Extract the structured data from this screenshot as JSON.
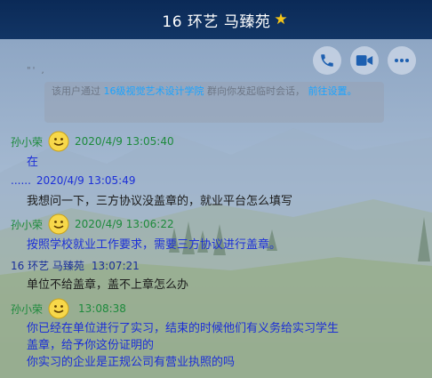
{
  "header": {
    "title": "16  环艺  马臻苑",
    "star_icon": "star-icon"
  },
  "toolbar": {
    "icons": [
      "phone-icon",
      "video-icon",
      "more-icon"
    ]
  },
  "notice": {
    "cut_top": "\"' ,",
    "prefix": "该用户通过",
    "group_link": "16级视觉艺术设计学院",
    "middle": "群向你发起临时会话，",
    "action_link": "前往设置。"
  },
  "messages": [
    {
      "sender": "孙小荣",
      "time": "2020/4/9 13:05:40",
      "text": "在"
    },
    {
      "sender": "......",
      "time": "2020/4/9 13:05:49",
      "text": "我想问一下，三方协议没盖章的，就业平台怎么填写"
    },
    {
      "sender": "孙小荣",
      "time": "2020/4/9 13:06:22",
      "text": "按照学校就业工作要求，需要三方协议进行盖章。"
    },
    {
      "sender": "16  环艺  马臻苑",
      "time": "13:07:21",
      "text": "单位不给盖章，盖不上章怎么办"
    },
    {
      "sender": "孙小荣",
      "time": "13:08:38",
      "lines": [
        "你已经在单位进行了实习，结束的时候他们有义务给实习学生",
        "盖章，给予你这份证明的",
        "你实习的企业是正规公司有营业执照的吗"
      ]
    }
  ],
  "colors": {
    "title_bg": "#0b2a57",
    "green": "#1d8a3c",
    "blue": "#1c2fd8",
    "link": "#1aa3ff"
  }
}
